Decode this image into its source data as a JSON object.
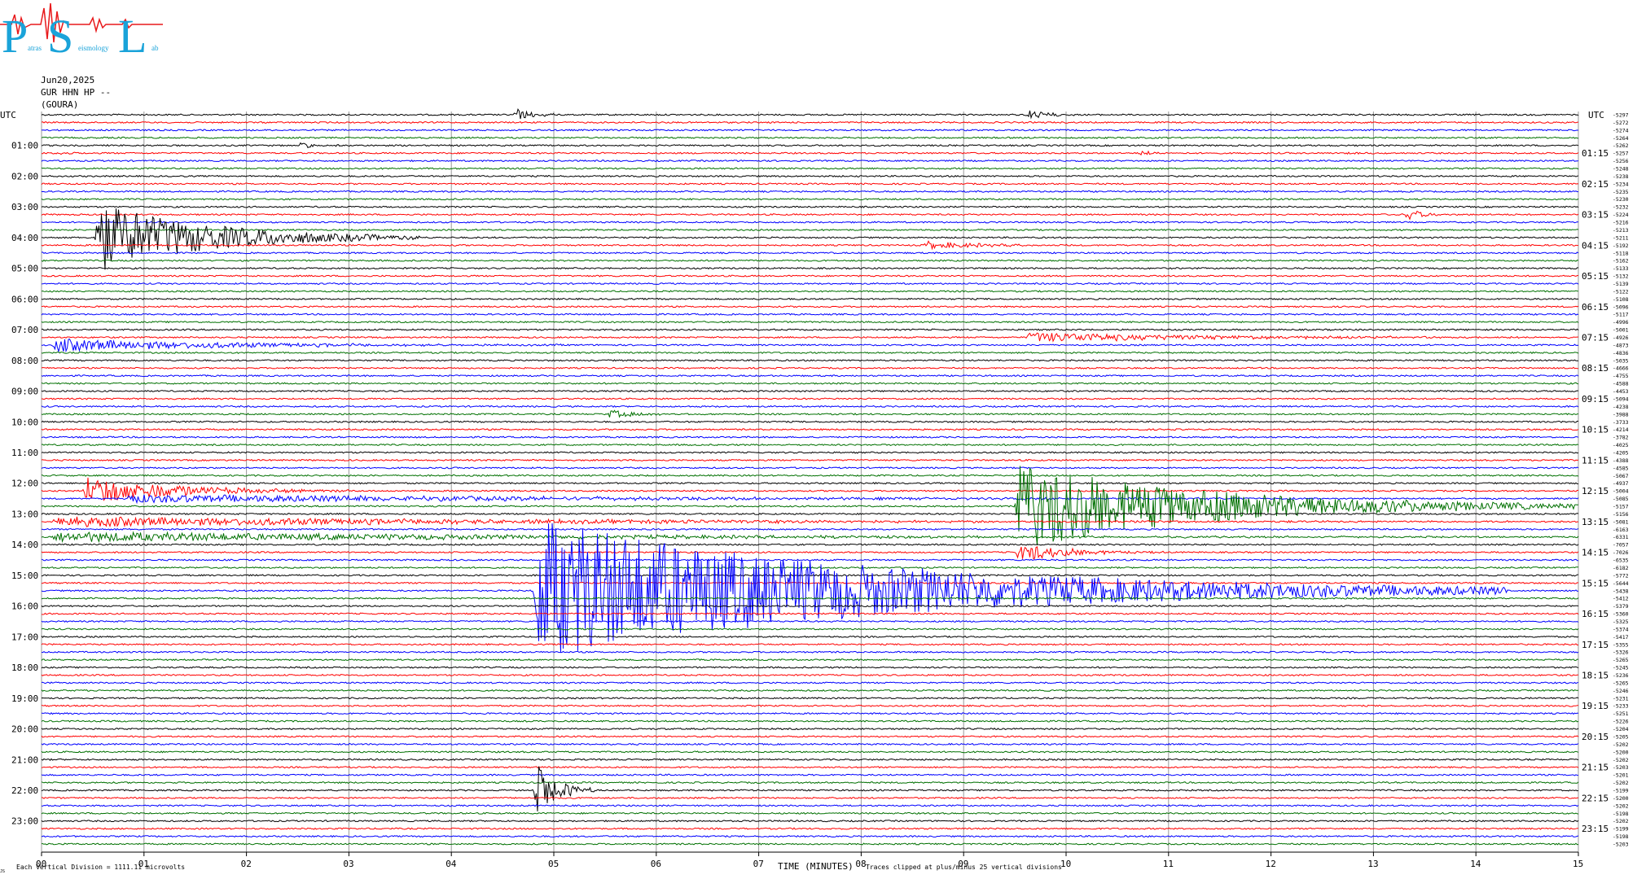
{
  "header": {
    "date": "Jun20,2025",
    "station": "GUR HHN HP --",
    "location": "(GOURA)"
  },
  "logo": {
    "text_letters": [
      "P",
      "S",
      "L"
    ],
    "small_text_1": "atras",
    "small_text_2": "eismology",
    "small_text_3": "ab",
    "color": "#1aa3d9",
    "trace_color": "#e8191b"
  },
  "axis": {
    "left_title": "UTC",
    "right_title": "UTC",
    "xlabel": "TIME (MINUTES)",
    "x_ticks": [
      "00",
      "01",
      "02",
      "03",
      "04",
      "05",
      "06",
      "07",
      "08",
      "09",
      "10",
      "11",
      "12",
      "13",
      "14",
      "15"
    ],
    "left_hours": [
      "01:00",
      "02:00",
      "03:00",
      "04:00",
      "05:00",
      "06:00",
      "07:00",
      "08:00",
      "09:00",
      "10:00",
      "11:00",
      "12:00",
      "13:00",
      "14:00",
      "15:00",
      "16:00",
      "17:00",
      "18:00",
      "19:00",
      "20:00",
      "21:00",
      "22:00",
      "23:00"
    ],
    "right_hours": [
      "01:15",
      "02:15",
      "03:15",
      "04:15",
      "05:15",
      "06:15",
      "07:15",
      "08:15",
      "09:15",
      "10:15",
      "11:15",
      "12:15",
      "13:15",
      "14:15",
      "15:15",
      "16:15",
      "17:15",
      "18:15",
      "19:15",
      "20:15",
      "21:15",
      "22:15",
      "23:15"
    ]
  },
  "footer": {
    "left_note": "Each Vertical Division = 1111.11 microvolts",
    "right_note": "Traces clipped at plus/minus 25 vertical divisions",
    "corner_mark": "JS"
  },
  "chart_data": {
    "type": "line",
    "title": "",
    "xlabel": "TIME (MINUTES)",
    "ylabel": "UTC",
    "xlim": [
      0,
      15
    ],
    "trace_colors": [
      "#000000",
      "#ff0000",
      "#0000ff",
      "#007000"
    ],
    "trace_minutes": 15,
    "trace_count": 96,
    "right_offsets": [
      "-5297",
      "-5272",
      "-5274",
      "-5264",
      "-5262",
      "-5257",
      "-5256",
      "-5248",
      "-5238",
      "-5234",
      "-5235",
      "-5230",
      "-5232",
      "-5224",
      "-5216",
      "-5213",
      "-5211",
      "-5192",
      "-5118",
      "-5162",
      "-5133",
      "-5132",
      "-5139",
      "-5122",
      "-5108",
      "-5096",
      "-5117",
      "-4996",
      "-5001",
      "-4926",
      "-4873",
      "-4836",
      "-5035",
      "-4666",
      "-4755",
      "-4588",
      "-4453",
      "-5094",
      "-4238",
      "-3988",
      "-3733",
      "-4214",
      "-3782",
      "-4025",
      "-4205",
      "-4388",
      "-4585",
      "-5067",
      "-4937",
      "-5004",
      "-5085",
      "-5157",
      "-5156",
      "-5081",
      "-6163",
      "-6331",
      "-7057",
      "-7026",
      "-6535",
      "-6182",
      "-5772",
      "-5644",
      "-5438",
      "-5412",
      "-5379",
      "-5360",
      "-5325",
      "-5374",
      "-5417",
      "-5355",
      "-5326",
      "-5265",
      "-5245",
      "-5236",
      "-5265",
      "-5246",
      "-5231",
      "-5233",
      "-5251",
      "-5226",
      "-5204",
      "-5205",
      "-5202",
      "-5200",
      "-5202",
      "-5203",
      "-5201",
      "-5202",
      "-5199",
      "-5200",
      "-5202",
      "-5198",
      "-5202",
      "-5199",
      "-5198",
      "-5203"
    ],
    "events": [
      {
        "trace": 0,
        "minute": 4.6,
        "amp": 9,
        "dur": 0.5,
        "freq": 2.5
      },
      {
        "trace": 0,
        "minute": 9.6,
        "amp": 8,
        "dur": 0.5,
        "freq": 2.5
      },
      {
        "trace": 4,
        "minute": 2.5,
        "amp": 5,
        "dur": 0.4,
        "freq": 2.5
      },
      {
        "trace": 5,
        "minute": 0.1,
        "amp": 3,
        "dur": 0.3,
        "freq": 2.5
      },
      {
        "trace": 5,
        "minute": 10.7,
        "amp": 4,
        "dur": 0.4,
        "freq": 2.5
      },
      {
        "trace": 5,
        "minute": 12.7,
        "amp": 3,
        "dur": 0.3,
        "freq": 2.5
      },
      {
        "trace": 13,
        "minute": 13.3,
        "amp": 12,
        "dur": 0.4,
        "freq": 2.5
      },
      {
        "trace": 16,
        "minute": 0.5,
        "amp": 45,
        "dur": 3.2,
        "freq": 3
      },
      {
        "trace": 17,
        "minute": 8.6,
        "amp": 5,
        "dur": 1.5,
        "freq": 2
      },
      {
        "trace": 30,
        "minute": 0.1,
        "amp": 8,
        "dur": 5.0,
        "freq": 1.5
      },
      {
        "trace": 29,
        "minute": 9.6,
        "amp": 6,
        "dur": 5.4,
        "freq": 1.5
      },
      {
        "trace": 39,
        "minute": 5.5,
        "amp": 6,
        "dur": 0.8,
        "freq": 2.5
      },
      {
        "trace": 49,
        "minute": 0.4,
        "amp": 18,
        "dur": 2.6,
        "freq": 3
      },
      {
        "trace": 50,
        "minute": 0.8,
        "amp": 5,
        "dur": 14.2,
        "freq": 1.5
      },
      {
        "trace": 51,
        "minute": 9.5,
        "amp": 55,
        "dur": 5.5,
        "freq": 3.5
      },
      {
        "trace": 53,
        "minute": 0.1,
        "amp": 6,
        "dur": 14.8,
        "freq": 2
      },
      {
        "trace": 55,
        "minute": 0.1,
        "amp": 6,
        "dur": 14.8,
        "freq": 2
      },
      {
        "trace": 57,
        "minute": 9.5,
        "amp": 12,
        "dur": 1.5,
        "freq": 2.5
      },
      {
        "trace": 62,
        "minute": 4.8,
        "amp": 90,
        "dur": 9.5,
        "freq": 3.5
      },
      {
        "trace": 88,
        "minute": 4.8,
        "amp": 40,
        "dur": 0.6,
        "freq": 3
      }
    ]
  }
}
